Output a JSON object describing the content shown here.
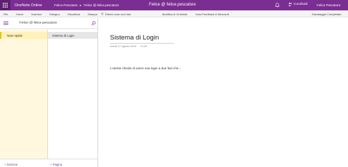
{
  "topbar": {
    "app_name": "OneNote Online",
    "breadcrumb": [
      "Felice Pescatore",
      "Felice @ felice.pescatore"
    ],
    "breadcrumb_sep": "▸",
    "document_title": "Felice @ felice.pescatore",
    "share_label": "Condividi",
    "user_name": "Felice Pescatore"
  },
  "menu": {
    "items": [
      "File",
      "Home",
      "Inserisci",
      "Disegno",
      "Visualizza",
      "Stampa"
    ],
    "tell_me": "Dimmi cosa vuoi fare",
    "open_onenote": "Modifica in OneNote",
    "feedback": "Invia Feedback A Microsoft",
    "status": "Salvataggio Completato"
  },
  "notebook": {
    "name": "Felice @ felice.pescatore",
    "sections": [
      "Note rapide"
    ],
    "pages": [
      "Sistema di Login"
    ],
    "add_section": "+ Sezione",
    "add_page": "+ Pagina"
  },
  "page": {
    "title": "Sistema di Login",
    "date": "lunedì 27 agosto 2018",
    "time": "10:26",
    "body": "L'utente chiede di avere una login a due fasi che..."
  },
  "colors": {
    "brand": "#7b2e91",
    "section_bg": "#fff8de",
    "section_accent": "#e8c400"
  },
  "icons": [
    "waffle-icon",
    "bell-icon",
    "share-icon",
    "hamburger-icon",
    "search-icon",
    "lightbulb-icon"
  ]
}
